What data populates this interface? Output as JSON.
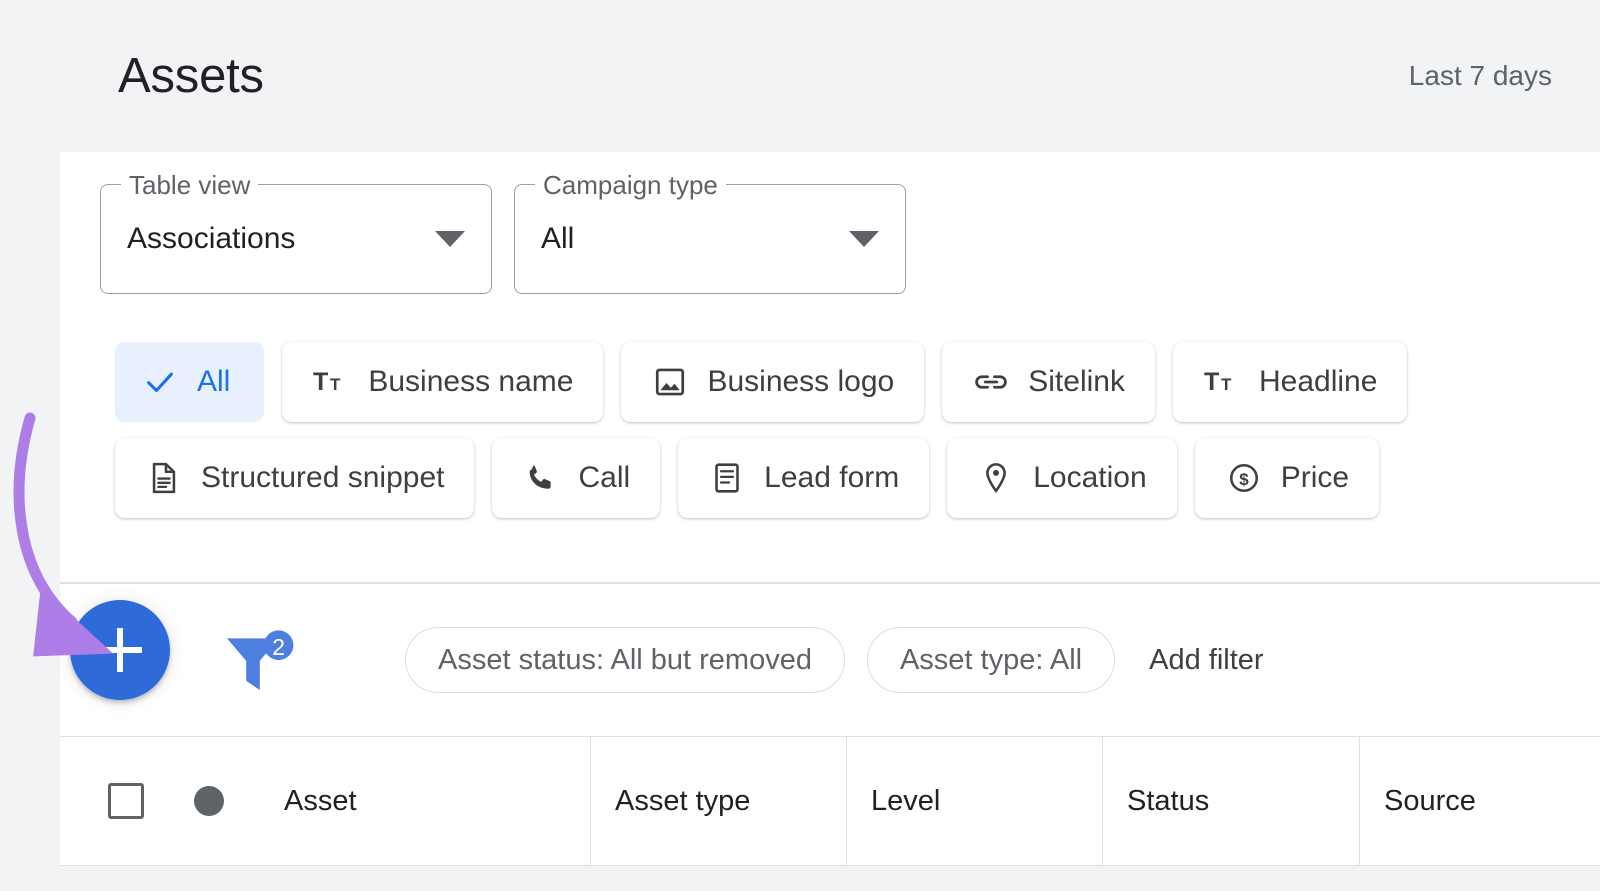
{
  "header": {
    "title": "Assets",
    "date_range": "Last 7 days"
  },
  "selectors": [
    {
      "legend": "Table view",
      "value": "Associations",
      "icon": "chevron-down-icon"
    },
    {
      "legend": "Campaign type",
      "value": "All",
      "icon": "chevron-down-icon"
    }
  ],
  "asset_type_chips": {
    "row1": [
      {
        "label": "All",
        "icon": "check-icon",
        "selected": true
      },
      {
        "label": "Business name",
        "icon": "text-format-icon",
        "selected": false
      },
      {
        "label": "Business logo",
        "icon": "image-icon",
        "selected": false
      },
      {
        "label": "Sitelink",
        "icon": "link-icon",
        "selected": false
      },
      {
        "label": "Headline",
        "icon": "text-format-icon",
        "selected": false
      }
    ],
    "row2": [
      {
        "label": "Structured snippet",
        "icon": "document-icon",
        "selected": false
      },
      {
        "label": "Call",
        "icon": "phone-icon",
        "selected": false
      },
      {
        "label": "Lead form",
        "icon": "form-icon",
        "selected": false
      },
      {
        "label": "Location",
        "icon": "location-pin-icon",
        "selected": false
      },
      {
        "label": "Price",
        "icon": "dollar-circle-icon",
        "selected": false
      }
    ]
  },
  "toolbar": {
    "add_button_label": "+",
    "filter_count_badge": "2",
    "filter_chips": [
      {
        "label": "Asset status: All but removed"
      },
      {
        "label": "Asset type: All"
      }
    ],
    "add_filter_label": "Add filter"
  },
  "table": {
    "columns": [
      {
        "label": "Asset"
      },
      {
        "label": "Asset type"
      },
      {
        "label": "Level"
      },
      {
        "label": "Status"
      },
      {
        "label": "Source"
      }
    ]
  },
  "colors": {
    "accent_blue": "#1a73e8",
    "fab_blue": "#2f6ad9",
    "chip_selected_bg": "#e8f0fe",
    "annotation_purple": "#ae7ee8",
    "page_bg": "#f1f3f4"
  }
}
